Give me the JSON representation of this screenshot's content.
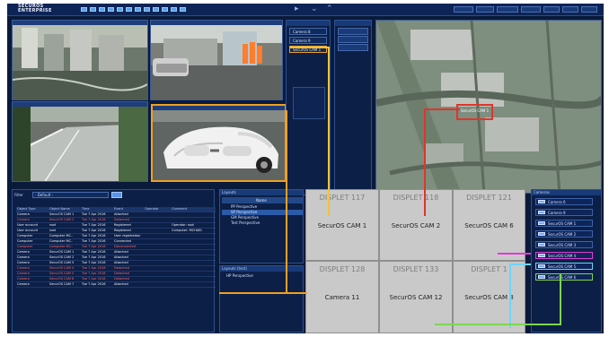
{
  "app": {
    "brand_line1": "SECUROS",
    "brand_line2": "ENTERPRISE"
  },
  "topbar": {
    "controls": [
      "▸",
      "⌄",
      "⌃"
    ]
  },
  "cameras": {
    "top_left_title": "",
    "top_right_title": "",
    "bottom_left_title": "",
    "focus_title": ""
  },
  "camera_list": {
    "title": "",
    "items": [
      "Camera 8",
      "Camera 9",
      "SecurOS CAM 1"
    ]
  },
  "side_list": {
    "title": "",
    "items": [
      "",
      "",
      ""
    ]
  },
  "map": {
    "labels": [
      "SecurOS CAM 1"
    ]
  },
  "events": {
    "filter_label": "Filter",
    "filter_value": "- Default -",
    "columns": [
      "Object Type",
      "Object Name",
      "Time",
      "Event",
      "Operator",
      "Comment"
    ],
    "rows": [
      {
        "type": "Camera",
        "name": "SecurOS CAM 1",
        "time": "Tue 7 Apr 2016",
        "event": "Attached",
        "op": "",
        "comment": "",
        "color": "#f3f6ff"
      },
      {
        "type": "Camera",
        "name": "SecurOS CAM 2",
        "time": "Tue 7 Apr 2016",
        "event": "Detached",
        "op": "",
        "comment": "",
        "color": "#ff6a6a"
      },
      {
        "type": "User account",
        "name": "root",
        "time": "Tue 7 Apr 2016",
        "event": "Registered",
        "op": "",
        "comment": "Operator: root",
        "color": "#f3f6ff"
      },
      {
        "type": "User account",
        "name": "root",
        "time": "Tue 7 Apr 2016",
        "event": "Registered",
        "op": "",
        "comment": "Computer: MCHAEL",
        "color": "#f3f6ff"
      },
      {
        "type": "Computer",
        "name": "Computer MC..",
        "time": "Tue 7 Apr 2016",
        "event": "User registration",
        "op": "",
        "comment": "",
        "color": "#f3f6ff"
      },
      {
        "type": "Computer",
        "name": "Computer MC..",
        "time": "Tue 7 Apr 2016",
        "event": "Connected",
        "op": "",
        "comment": "",
        "color": "#f3f6ff"
      },
      {
        "type": "Computer",
        "name": "Computer MC..",
        "time": "Tue 7 Apr 2016",
        "event": "Disconnected",
        "op": "",
        "comment": "",
        "color": "#ff6a6a"
      },
      {
        "type": "Camera",
        "name": "SecurOS CAM 1",
        "time": "Tue 7 Apr 2016",
        "event": "Attached",
        "op": "",
        "comment": "",
        "color": "#f3f6ff"
      },
      {
        "type": "Camera",
        "name": "SecurOS CAM 2",
        "time": "Tue 7 Apr 2016",
        "event": "Attached",
        "op": "",
        "comment": "",
        "color": "#f3f6ff"
      },
      {
        "type": "Camera",
        "name": "SecurOS CAM 3",
        "time": "Tue 7 Apr 2016",
        "event": "Attached",
        "op": "",
        "comment": "",
        "color": "#f3f6ff"
      },
      {
        "type": "Camera",
        "name": "SecurOS CAM 4",
        "time": "Tue 7 Apr 2016",
        "event": "Detached",
        "op": "",
        "comment": "",
        "color": "#ff6a6a"
      },
      {
        "type": "Camera",
        "name": "SecurOS CAM 5",
        "time": "Tue 7 Apr 2016",
        "event": "Detached",
        "op": "",
        "comment": "",
        "color": "#ff6a6a"
      },
      {
        "type": "Camera",
        "name": "SecurOS CAM 6",
        "time": "Tue 7 Apr 2016",
        "event": "Detached",
        "op": "",
        "comment": "",
        "color": "#ff6a6a"
      },
      {
        "type": "Camera",
        "name": "SecurOS CAM 7",
        "time": "Tue 7 Apr 2016",
        "event": "Attached",
        "op": "",
        "comment": "",
        "color": "#f3f6ff"
      }
    ]
  },
  "layouts": {
    "title": "Layouts",
    "header_name": "Name",
    "items": [
      "PP Perspective",
      "SP Perspective",
      "GM Perspective",
      "Test Perspective"
    ]
  },
  "layouts2": {
    "title": "Layouts (test)",
    "items": [
      "HP Perspective"
    ]
  },
  "grid": [
    {
      "top": "DISPLET 117",
      "main": "SecurOS CAM 1"
    },
    {
      "top": "DISPLET 118",
      "main": "SecurOS CAM 2"
    },
    {
      "top": "DISPLET 121",
      "main": "SecurOS CAM 6"
    },
    {
      "top": "DISPLET 128",
      "main": "Camera 11"
    },
    {
      "top": "DISPLET 133",
      "main": "SecurOS CAM 12"
    },
    {
      "top": "DISPLET 1",
      "main": "SecurOS CAM 8"
    }
  ],
  "devices": {
    "title": "Cameras",
    "items": [
      "Camera 6",
      "Camera 9",
      "SecurOS CAM 1",
      "SecurOS CAM 2",
      "SecurOS CAM 3",
      "SecurOS CAM 4",
      "SecurOS CAM 5",
      "SecurOS CAM 6"
    ]
  },
  "colors": {
    "accent": "#f0a020",
    "link_yellow": "#f1c23a",
    "link_red": "#e0352b",
    "link_magenta": "#e43ad7",
    "link_cyan": "#6ed5ff",
    "link_green": "#7bd650"
  }
}
